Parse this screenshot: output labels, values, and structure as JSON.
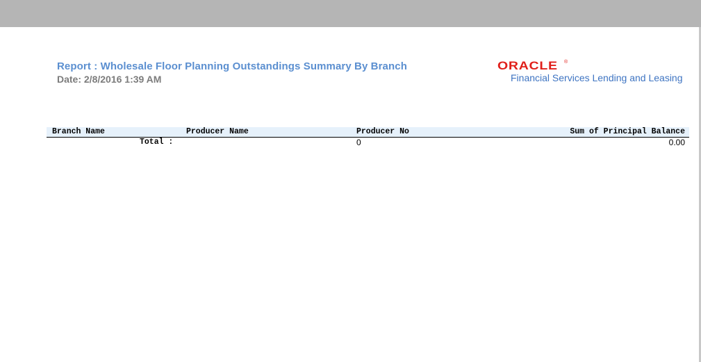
{
  "report": {
    "title": "Report :  Wholesale Floor Planning Outstandings Summary By Branch",
    "date": "Date: 2/8/2016  1:39 AM"
  },
  "logo": {
    "wordmark": "ORACLE",
    "trademark": "®",
    "subtitle": "Financial Services Lending and Leasing"
  },
  "table": {
    "columns": {
      "branch_name": "Branch Name",
      "producer_name": "Producer Name",
      "producer_no": "Producer No",
      "sum_principal": "Sum of Principal Balance"
    },
    "total_row": {
      "label": "Total :",
      "producer_no": "0",
      "sum_principal": "0.00"
    }
  },
  "colors": {
    "title": "#5b8fd0",
    "date": "#7c7c7c",
    "oracle_red": "#e0201b",
    "oracle_blue": "#3e74c2",
    "header_bg": "#e6f1fb",
    "top_bar": "#b5b5b5"
  }
}
